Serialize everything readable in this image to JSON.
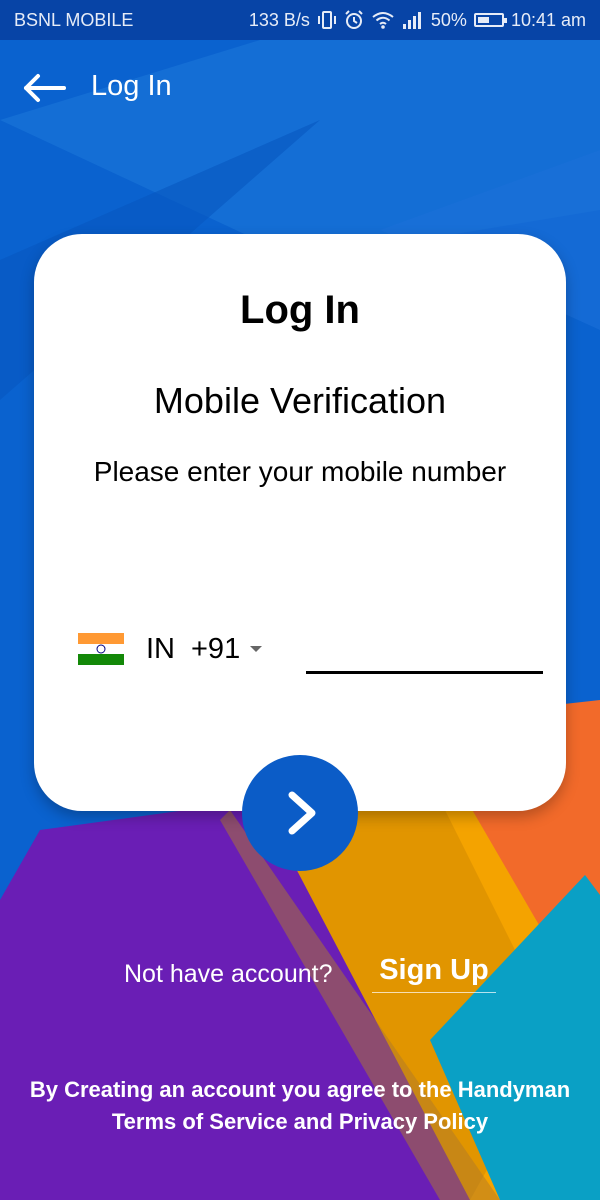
{
  "status_bar": {
    "carrier": "BSNL MOBILE",
    "data_rate": "133 B/s",
    "battery_percent": "50%",
    "battery_level": 0.5,
    "time": "10:41 am",
    "icons": [
      "vibrate-icon",
      "alarm-icon",
      "wifi-icon",
      "signal-icon",
      "battery-icon"
    ]
  },
  "app_bar": {
    "back_icon": "arrow-left-icon",
    "title": "Log In"
  },
  "card": {
    "title": "Log In",
    "subtitle": "Mobile Verification",
    "instruction": "Please enter your mobile number",
    "country_code": "IN",
    "dial_code": "+91",
    "phone_value": "",
    "phone_placeholder": ""
  },
  "next_button": {
    "icon": "chevron-right-icon"
  },
  "signup": {
    "prompt": "Not have account?",
    "link_label": "Sign Up"
  },
  "terms": {
    "line1": "By Creating an account you agree to the Handyman",
    "line2": "Terms of Service and Privacy Policy"
  },
  "colors": {
    "primary_blue": "#0a62cf",
    "status_bar": "#0744a6",
    "purple": "#6a1eb5",
    "orange": "#f4a300",
    "red_orange": "#f26a2a",
    "teal": "#0aa0c5",
    "button_blue": "#0b5cc7"
  }
}
